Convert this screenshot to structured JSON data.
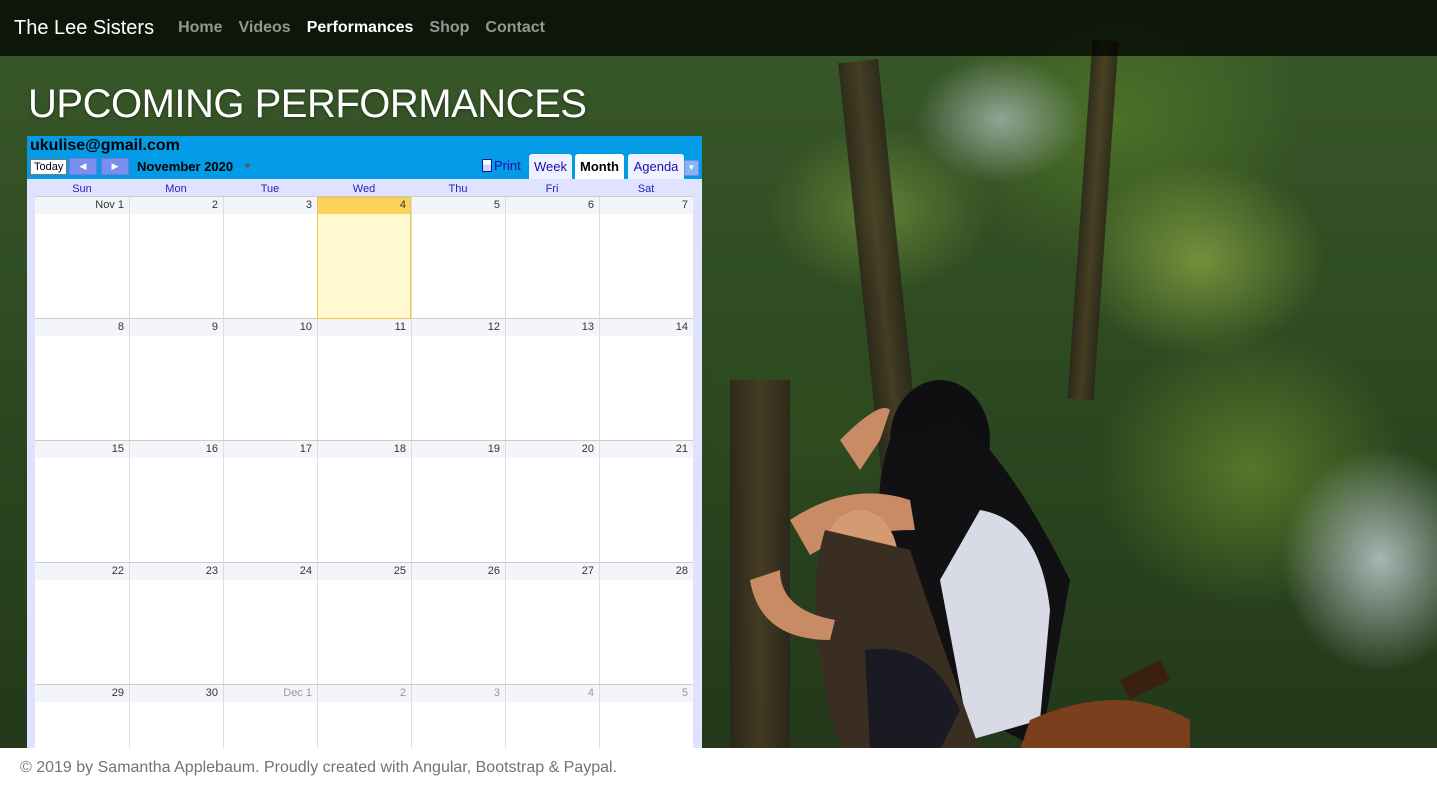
{
  "navbar": {
    "brand": "The Lee Sisters",
    "links": [
      {
        "label": "Home",
        "active": false
      },
      {
        "label": "Videos",
        "active": false
      },
      {
        "label": "Performances",
        "active": true
      },
      {
        "label": "Shop",
        "active": false
      },
      {
        "label": "Contact",
        "active": false
      }
    ]
  },
  "page": {
    "title": "UPCOMING PERFORMANCES"
  },
  "calendar": {
    "account": "ukulise@gmail.com",
    "today_label": "Today",
    "month_label": "November 2020",
    "print_label": "Print",
    "tabs": [
      {
        "label": "Week",
        "active": false
      },
      {
        "label": "Month",
        "active": true
      },
      {
        "label": "Agenda",
        "active": false
      }
    ],
    "weekdays": [
      "Sun",
      "Mon",
      "Tue",
      "Wed",
      "Thu",
      "Fri",
      "Sat"
    ],
    "weeks": [
      [
        "Nov 1",
        "2",
        "3",
        "4",
        "5",
        "6",
        "7"
      ],
      [
        "8",
        "9",
        "10",
        "11",
        "12",
        "13",
        "14"
      ],
      [
        "15",
        "16",
        "17",
        "18",
        "19",
        "20",
        "21"
      ],
      [
        "22",
        "23",
        "24",
        "25",
        "26",
        "27",
        "28"
      ],
      [
        "29",
        "30",
        "Dec 1",
        "2",
        "3",
        "4",
        "5"
      ]
    ],
    "today_cell": {
      "week": 0,
      "day": 3
    },
    "other_month_from": {
      "week": 4,
      "day": 2
    },
    "colors": {
      "header": "#039be5",
      "today_header": "#fbd35a",
      "today_bg": "#fff8d1",
      "weekday_text": "#2222bb"
    }
  },
  "footer": {
    "text": "© 2019 by Samantha Applebaum. Proudly created with Angular, Bootstrap & Paypal."
  }
}
